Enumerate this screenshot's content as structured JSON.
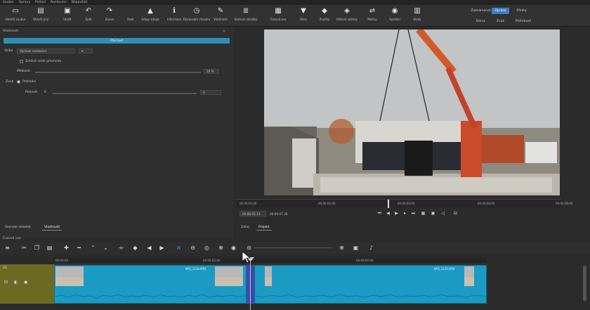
{
  "menu": [
    "Soubor",
    "Úpravy",
    "Pohled",
    "Nastavení",
    "Nápověda"
  ],
  "toolbar": {
    "buttons": [
      {
        "label": "Otevřít soubor",
        "icon": "folder-open-icon",
        "glyph": "▭"
      },
      {
        "label": "Otevřít jiný",
        "icon": "open-other-icon",
        "glyph": "▤"
      },
      {
        "label": "Uložit",
        "icon": "save-icon",
        "glyph": "▣"
      },
      {
        "label": "Zpět",
        "icon": "undo-icon",
        "glyph": "↶"
      },
      {
        "label": "Znovu",
        "icon": "redo-icon",
        "glyph": "↷"
      },
      {
        "label": "Peak",
        "icon": "peak-icon",
        "glyph": ""
      },
      {
        "label": "Údaje zdroje",
        "icon": "source-info-icon",
        "glyph": "▲"
      },
      {
        "label": "Informace",
        "icon": "info-icon",
        "glyph": "ℹ"
      },
      {
        "label": "Dosavadní chování",
        "icon": "history-icon",
        "glyph": "◷"
      },
      {
        "label": "Vlastnosti",
        "icon": "properties-icon",
        "glyph": "✎"
      },
      {
        "label": "Seznam skladby",
        "icon": "playlist-icon",
        "glyph": "≣"
      },
      {
        "label": "Časová osa",
        "icon": "timeline-icon",
        "glyph": "▦"
      },
      {
        "label": "Filtry",
        "icon": "filter-icon",
        "glyph": "▼"
      },
      {
        "label": "Značky",
        "icon": "markers-icon",
        "glyph": "◆"
      },
      {
        "label": "Klíčové snímky",
        "icon": "keyframes-icon",
        "glyph": "◈"
      },
      {
        "label": "Motivy",
        "icon": "motion-icon",
        "glyph": "⇌"
      },
      {
        "label": "Vysílání",
        "icon": "broadcast-icon",
        "glyph": "◉"
      },
      {
        "label": "Úkoly",
        "icon": "jobs-icon",
        "glyph": "▥"
      }
    ],
    "layouts_top": [
      "Zaznamenat",
      "Úpravy",
      "Efekty"
    ],
    "layouts_bottom": [
      "Barva",
      "Zvuk",
      "Přehrávač"
    ],
    "active_layout": "Úpravy"
  },
  "filters": {
    "panel_title": "Vlastnosti",
    "filter_name": "Přechod",
    "preset_label": "Volba",
    "preset_value": "Výchozí nastavení",
    "option_label": "Změnit směr přechodu",
    "softness_label": "Měkkost",
    "softness_value": "20 %",
    "fade_label": "Zvuk",
    "fade_option": "Prolínání",
    "position_label": "Prolnutí",
    "position_value": "0"
  },
  "player": {
    "timecodes": [
      "00:00:00:00",
      "00:00:02:00",
      "00:00:04:00",
      "00:00:06:00",
      "00:00:08:00"
    ],
    "current_time": "00:00:05:13",
    "duration": "00:00:07:26",
    "tabs": [
      "Zdroj",
      "Projekt"
    ],
    "active_tab": "Projekt"
  },
  "bottom_tabs": {
    "items": [
      "Seznam skladeb",
      "Vlastnosti"
    ],
    "active": "Vlastnosti"
  },
  "timeline": {
    "title": "Časová osa",
    "track_name": "V1",
    "ruler_labels": [
      "00:00:00",
      "00:00:02:00",
      "00:00:04:00"
    ],
    "clips": [
      {
        "label": "IMG_1234.MP4",
        "name": "clip-1"
      },
      {
        "label": "IMG_1235.MP4",
        "name": "clip-2"
      }
    ]
  },
  "colors": {
    "accent": "#3d7fc4",
    "clip": "#1b9bc3",
    "filter_bar": "#2f8fb3",
    "track_head": "#6b6a22"
  }
}
